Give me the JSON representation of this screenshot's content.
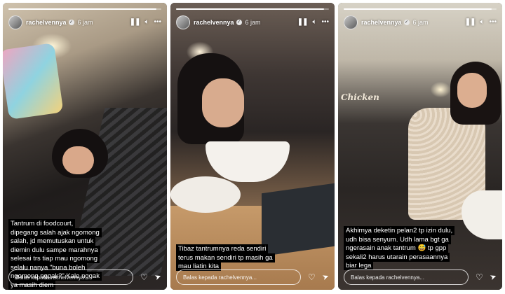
{
  "stories": [
    {
      "username": "rachelvennya",
      "time": "6 jam",
      "progress": 0.97,
      "caption": "Tantrum di foodcourt, dipegang salah ajak ngomong salah, jd memutuskan untuk diemin dulu sampe marahnya selesai trs tiap mau ngomong selalu nanya \"buna boleh ngomong nggak?\" Kalo nggak ya masih diem",
      "reply_placeholder": "Balas kepada rachelvennya..."
    },
    {
      "username": "rachelvennya",
      "time": "6 jam",
      "progress": 0.97,
      "caption": "Tibaz tantrumnya reda sendiri terus makan sendiri tp masih ga mau liatin kita",
      "reply_placeholder": "Balas kepada rachelvennya..."
    },
    {
      "username": "rachelvennya",
      "time": "6 jam",
      "progress": 0.97,
      "caption": "Akhirnya deketin pelan2 tp izin dulu, udh bisa senyum. Udh lama bgt ga ngerasain anak tantrum 😅 tp gpp sekali2 harus utarain perasaannya biar lega",
      "reply_placeholder": "Balas kepada rachelvennya..."
    }
  ],
  "icons": {
    "pause": "pause-icon",
    "volume": "volume-icon",
    "more": "more-icon",
    "verified": "verified-badge-icon",
    "like": "heart-icon",
    "share": "send-icon"
  },
  "scene_text": {
    "restaurant_sign": "Chicken"
  }
}
